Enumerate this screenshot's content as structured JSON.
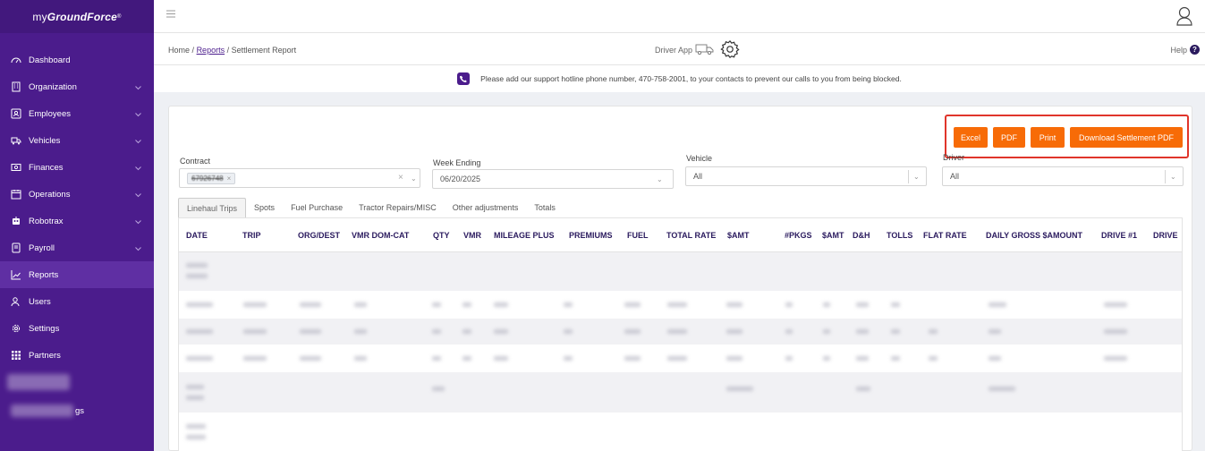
{
  "sidebar": {
    "brand_prefix": "my",
    "brand_bold": "GroundForce",
    "brand_reg": "®",
    "items": [
      {
        "label": "Dashboard",
        "icon": "dashboard-icon",
        "has_chevron": false
      },
      {
        "label": "Organization",
        "icon": "building-icon",
        "has_chevron": true
      },
      {
        "label": "Employees",
        "icon": "id-card-icon",
        "has_chevron": true
      },
      {
        "label": "Vehicles",
        "icon": "truck-icon",
        "has_chevron": true
      },
      {
        "label": "Finances",
        "icon": "money-icon",
        "has_chevron": true
      },
      {
        "label": "Operations",
        "icon": "calendar-icon",
        "has_chevron": true
      },
      {
        "label": "Robotrax",
        "icon": "robot-icon",
        "has_chevron": true
      },
      {
        "label": "Payroll",
        "icon": "payroll-icon",
        "has_chevron": true
      },
      {
        "label": "Reports",
        "icon": "chart-icon",
        "has_chevron": false,
        "active": true
      },
      {
        "label": "Users",
        "icon": "users-icon",
        "has_chevron": false
      },
      {
        "label": "Settings",
        "icon": "gear-icon",
        "has_chevron": false
      },
      {
        "label": "Partners",
        "icon": "grid-icon",
        "has_chevron": false
      }
    ],
    "partial_item_suffix": "gs"
  },
  "breadcrumb": {
    "home": "Home",
    "sep": "/",
    "reports": "Reports",
    "current": "Settlement Report"
  },
  "driver_app_label": "Driver App",
  "help_label": "Help",
  "help_glyph": "?",
  "notice_text": "Please add our support hotline phone number, 470-758-2001, to your contacts to prevent our calls to you from being blocked.",
  "buttons": {
    "excel": "Excel",
    "pdf": "PDF",
    "print": "Print",
    "download": "Download Settlement PDF"
  },
  "filters": {
    "contract_label": "Contract",
    "contract_chip": "67926748",
    "week_label": "Week Ending",
    "week_value": "06/20/2025",
    "vehicle_label": "Vehicle",
    "vehicle_value": "All",
    "driver_label": "Driver",
    "driver_value": "All"
  },
  "tabs": [
    "Linehaul Trips",
    "Spots",
    "Fuel Purchase",
    "Tractor Repairs/MISC",
    "Other adjustments",
    "Totals"
  ],
  "columns": [
    "DATE",
    "TRIP",
    "ORG/DEST",
    "VMR DOM-CAT",
    "QTY",
    "VMR",
    "MILEAGE PLUS",
    "PREMIUMS",
    "FUEL",
    "TOTAL RATE",
    "$AMT",
    "#PKGS",
    "$AMT",
    "D&H",
    "TOLLS",
    "FLAT RATE",
    "DAILY GROSS $AMOUNT",
    "DRIVE #1",
    "DRIVE"
  ],
  "colors": {
    "sidebar_bg": "#4b1c8c",
    "accent_orange": "#f76b07",
    "highlight_red": "#e0352b",
    "header_text": "#2a1a5e"
  }
}
